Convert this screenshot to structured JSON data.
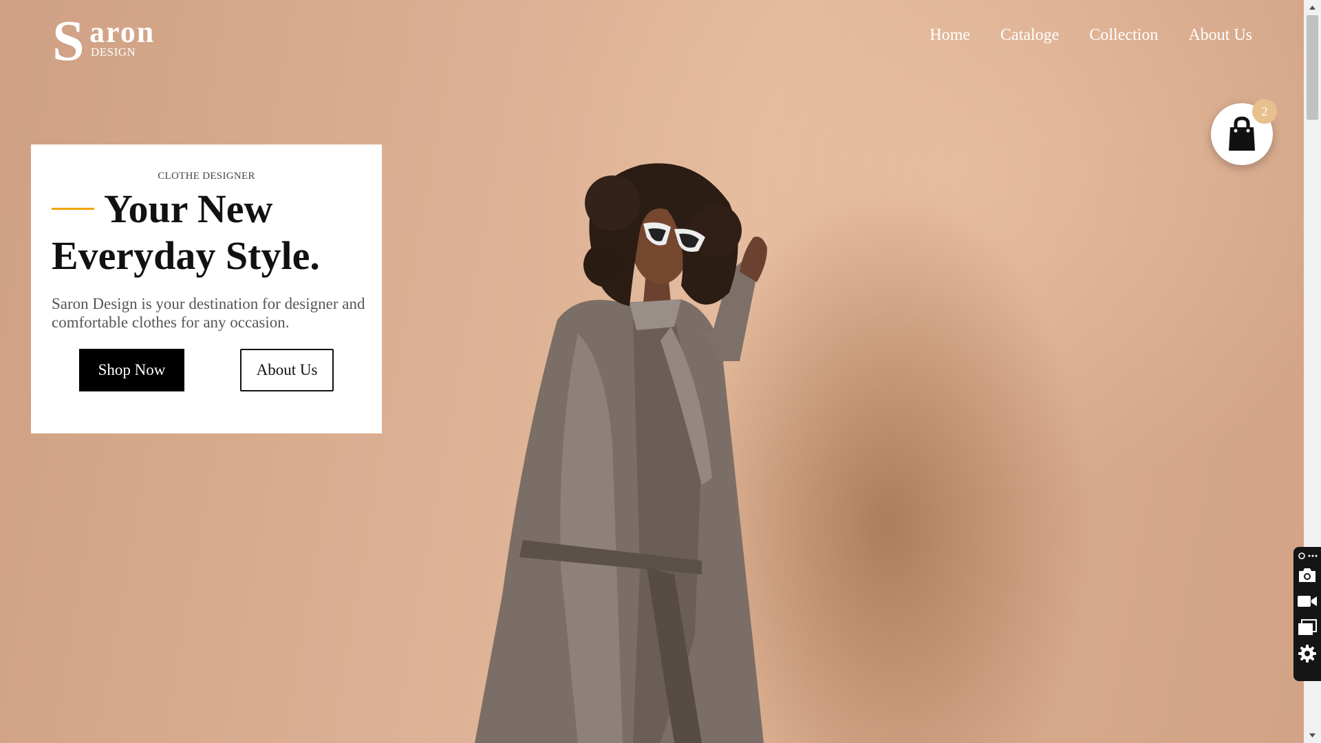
{
  "brand": {
    "letter": "S",
    "word": "aron",
    "sub": "DESIGN"
  },
  "nav": {
    "items": [
      "Home",
      "Cataloge",
      "Collection",
      "About Us"
    ]
  },
  "cart": {
    "count": "2"
  },
  "hero": {
    "eyebrow": "CLOTHE DESIGNER",
    "headline_line1": "Your New",
    "headline_line2": "Everyday Style.",
    "description": "Saron Design is your destination for designer and comfortable clothes for any occasion.",
    "primary_button": "Shop Now",
    "secondary_button": "About Us"
  },
  "colors": {
    "accent": "#f0a500",
    "background": "#d9ad8f",
    "badge": "#e8c08e"
  },
  "icons": [
    "shopping-bag-icon",
    "camera-icon",
    "video-icon",
    "window-icon",
    "gear-icon"
  ]
}
